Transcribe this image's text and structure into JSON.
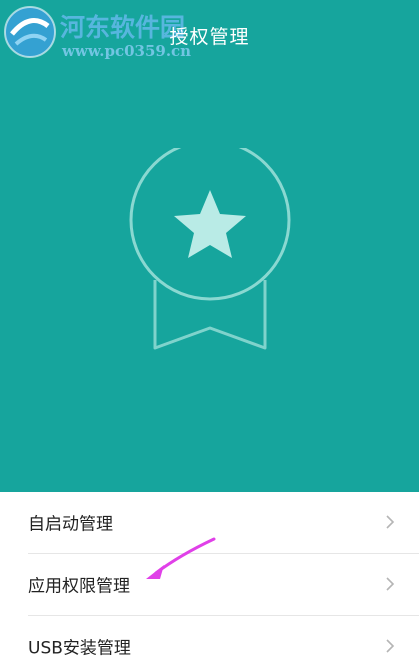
{
  "header": {
    "title": "授权管理",
    "background": "#16a59d",
    "emblem_icon": "star-medal-icon"
  },
  "watermark": {
    "name": "河东软件园",
    "url": "www.pc0359.cn"
  },
  "menu": {
    "items": [
      {
        "label": "自启动管理"
      },
      {
        "label": "应用权限管理"
      },
      {
        "label": "USB安装管理"
      }
    ],
    "chevron_icon": "chevron-right-icon"
  },
  "annotation": {
    "arrow_color": "#e040e8"
  }
}
